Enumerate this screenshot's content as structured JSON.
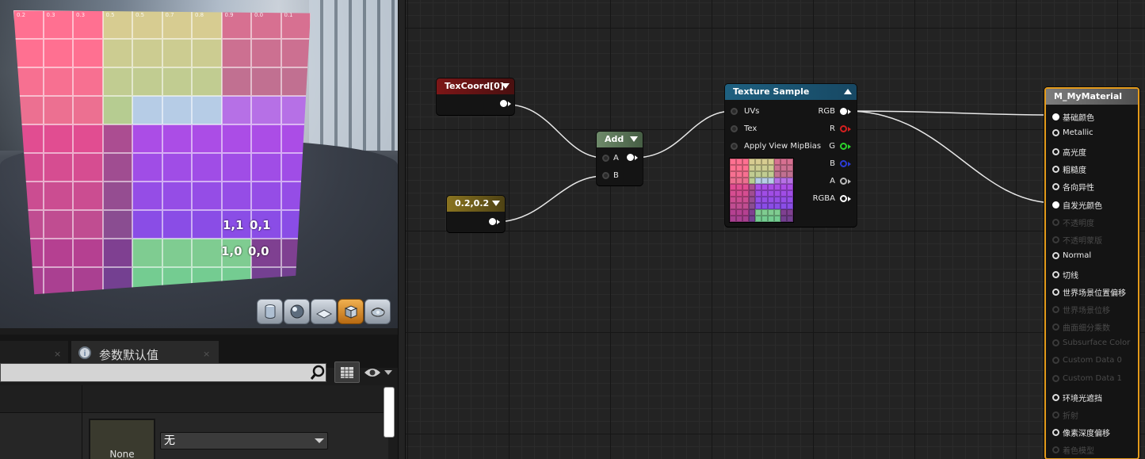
{
  "viewport": {
    "grid_cells_top_left": [
      "0.2",
      "0.3",
      "0.3",
      "0.5",
      "0.5",
      "0.7",
      "0.8",
      "0.9",
      "0.0",
      "0.1"
    ],
    "uv_labels": [
      "1,1",
      "0,1",
      "1,0",
      "0,0"
    ],
    "toolbar_icons": [
      "cylinder-preview-icon",
      "sphere-preview-icon",
      "plane-preview-icon",
      "cube-preview-icon",
      "custom-mesh-preview-icon"
    ]
  },
  "panel": {
    "params_tab_label": "参数默认值",
    "tab_close_glyph": "×",
    "thumbnail_label": "None",
    "texture_dropdown_value": "无"
  },
  "graph": {
    "texcoord": {
      "title": "TexCoord[0]"
    },
    "constant": {
      "title": "0.2,0.2"
    },
    "add": {
      "title": "Add",
      "pin_a": "A",
      "pin_b": "B"
    },
    "texture_sample": {
      "title": "Texture Sample",
      "inputs": [
        "UVs",
        "Tex",
        "Apply View MipBias"
      ],
      "outputs": [
        "RGB",
        "R",
        "G",
        "B",
        "A",
        "RGBA"
      ],
      "output_colors": [
        "#ffffff",
        "#d42020",
        "#2bd42b",
        "#2b3bd4",
        "#bbbbbb",
        "#ffffff"
      ]
    },
    "material": {
      "title": "M_MyMaterial",
      "pins": [
        {
          "label": "基础颜色",
          "enabled": true,
          "connected": true
        },
        {
          "label": "Metallic",
          "enabled": true,
          "connected": false
        },
        {
          "label": "高光度",
          "enabled": true,
          "connected": false
        },
        {
          "label": "粗糙度",
          "enabled": true,
          "connected": false
        },
        {
          "label": "各向异性",
          "enabled": true,
          "connected": false
        },
        {
          "label": "自发光颜色",
          "enabled": true,
          "connected": true
        },
        {
          "label": "不透明度",
          "enabled": false,
          "connected": false
        },
        {
          "label": "不透明蒙版",
          "enabled": false,
          "connected": false
        },
        {
          "label": "Normal",
          "enabled": true,
          "connected": false
        },
        {
          "label": "切线",
          "enabled": true,
          "connected": false
        },
        {
          "label": "世界场景位置偏移",
          "enabled": true,
          "connected": false
        },
        {
          "label": "世界场景位移",
          "enabled": false,
          "connected": false
        },
        {
          "label": "曲面细分乘数",
          "enabled": false,
          "connected": false
        },
        {
          "label": "Subsurface Color",
          "enabled": false,
          "connected": false
        },
        {
          "label": "Custom Data 0",
          "enabled": false,
          "connected": false
        },
        {
          "label": "Custom Data 1",
          "enabled": false,
          "connected": false
        },
        {
          "label": "环境光遮挡",
          "enabled": true,
          "connected": false
        },
        {
          "label": "折射",
          "enabled": false,
          "connected": false
        },
        {
          "label": "像素深度偏移",
          "enabled": true,
          "connected": false
        },
        {
          "label": "着色模型",
          "enabled": false,
          "connected": false
        }
      ]
    }
  }
}
